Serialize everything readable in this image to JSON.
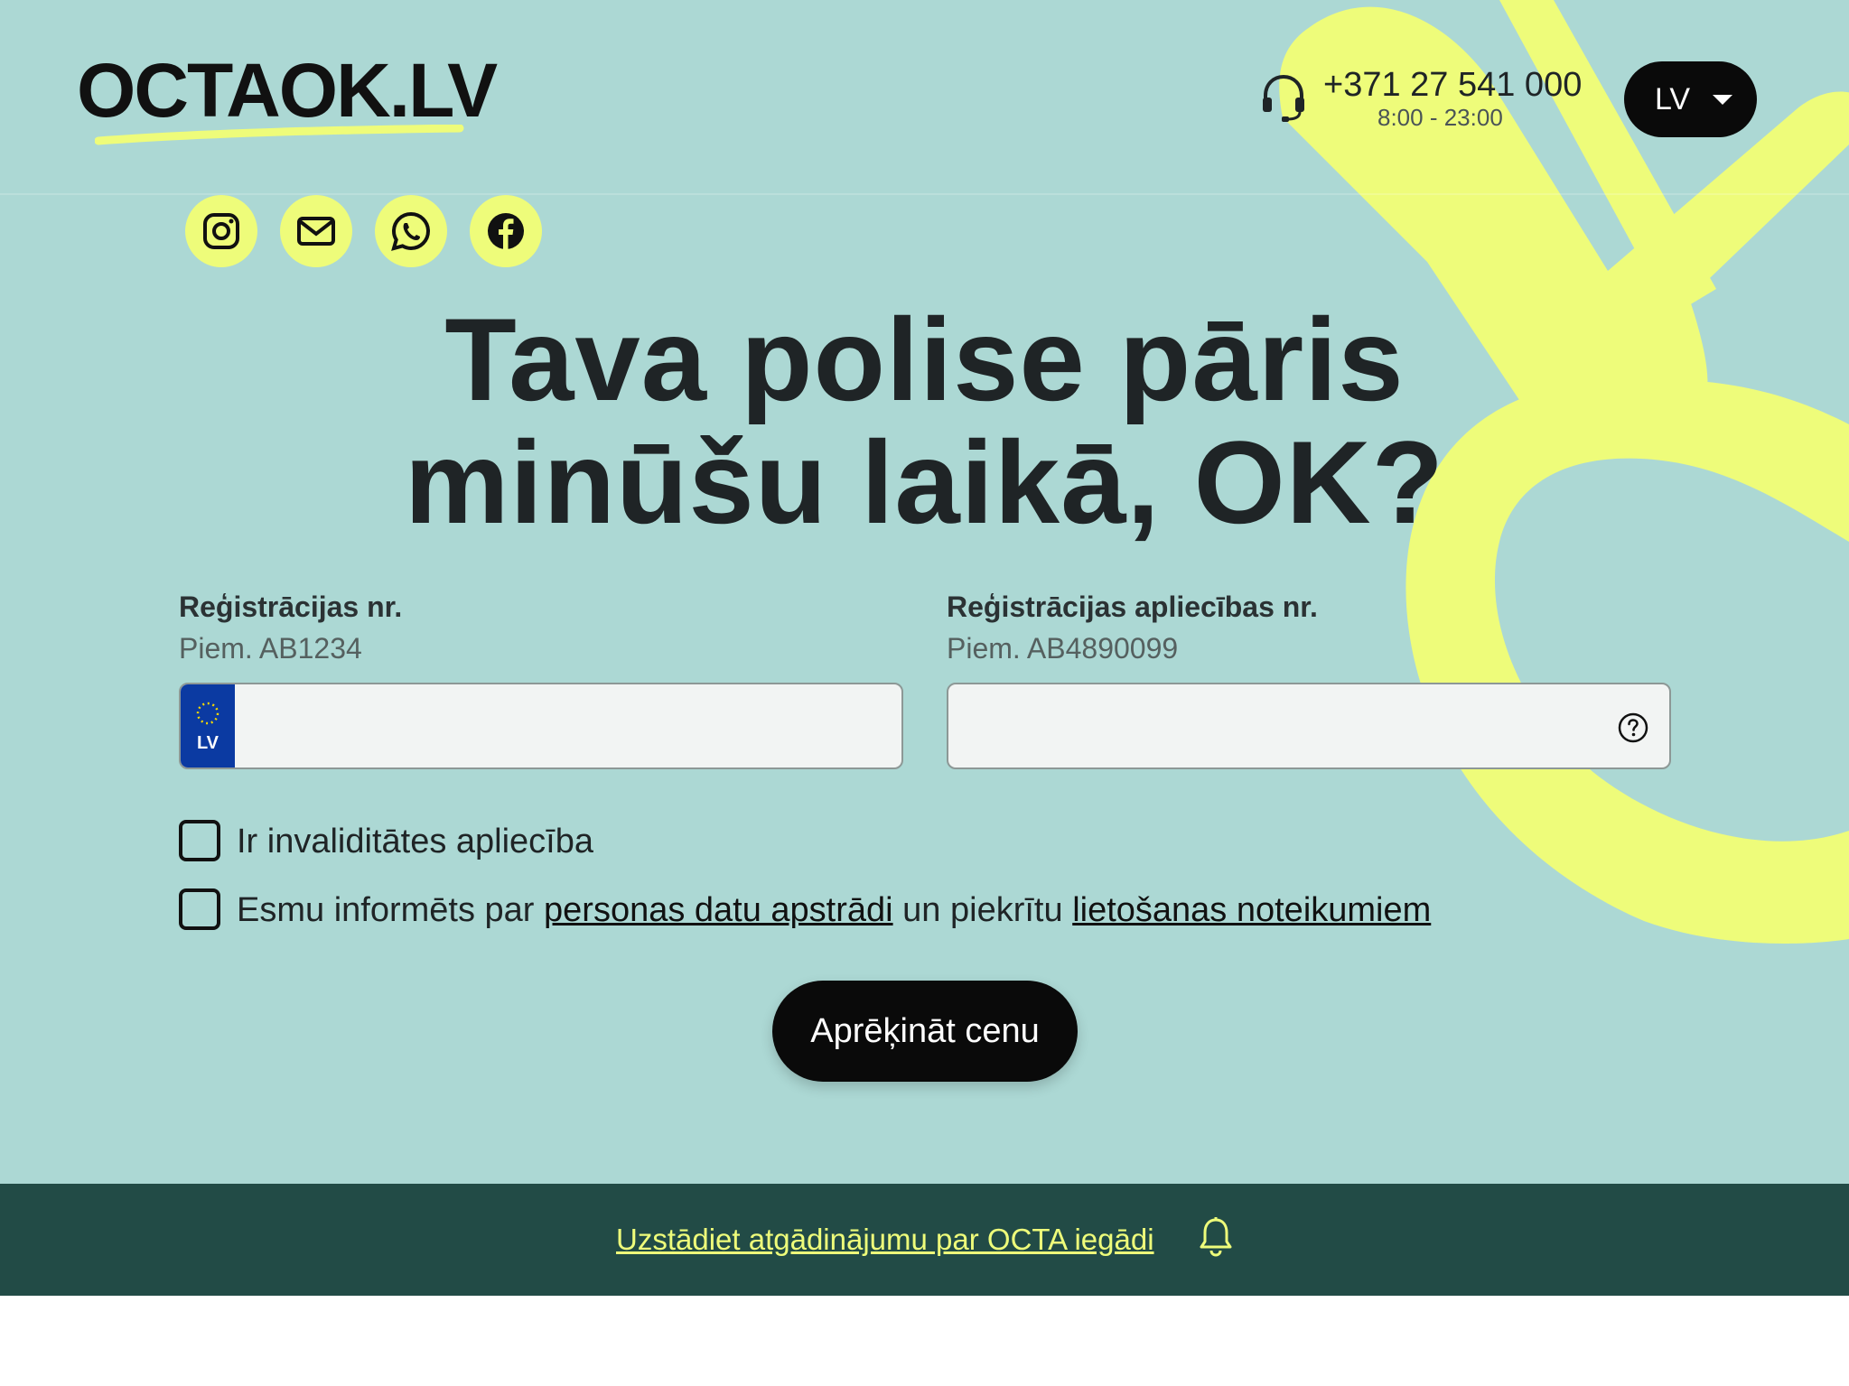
{
  "header": {
    "logo_text": "OCTAOK.LV",
    "phone_number": "+371 27 541 000",
    "phone_hours": "8:00 - 23:00",
    "language": "LV"
  },
  "social": [
    {
      "icon": "instagram-icon"
    },
    {
      "icon": "mail-icon"
    },
    {
      "icon": "whatsapp-icon"
    },
    {
      "icon": "facebook-icon"
    }
  ],
  "hero": {
    "headline_line1": "Tava polise pāris",
    "headline_line2": "minūšu laikā, OK?"
  },
  "form": {
    "reg_number": {
      "label": "Reģistrācijas nr.",
      "hint": "Piem. AB1234",
      "value": "",
      "plate_country": "LV"
    },
    "reg_cert_number": {
      "label": "Reģistrācijas apliecības nr.",
      "hint": "Piem. AB4890099",
      "value": ""
    },
    "disability_checkbox": {
      "label": "Ir invaliditātes apliecība",
      "checked": false
    },
    "consent_checkbox": {
      "text_before": "Esmu informēts par",
      "link1": "personas datu apstrādi",
      "text_middle": "un piekrītu",
      "link2": "lietošanas noteikumiem",
      "checked": false
    },
    "submit_label": "Aprēķināt cenu"
  },
  "banner": {
    "link_text": "Uzstādiet atgādinājumu par OCTA iegādi"
  },
  "colors": {
    "hero_bg": "#acd8d4",
    "accent_yellow": "#eefc7a",
    "banner_bg": "#224b46",
    "button_bg": "#0a0a0a",
    "eu_blue": "#0b3aa2"
  }
}
